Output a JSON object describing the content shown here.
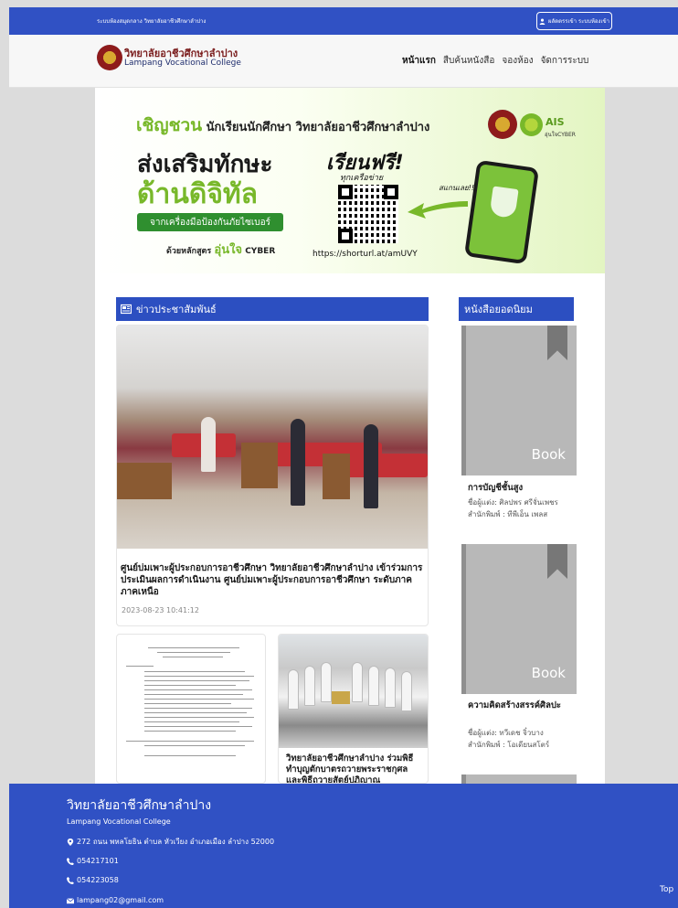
{
  "topbar": {
    "breadcrumb": "ระบบห้องสมุดกลาง วิทยาลัยอาชีวศึกษาลำปาง",
    "login_label": "ผลัดตรรเข้า ระบบห้องเข้า"
  },
  "brand": {
    "name_th": "วิทยาลัยอาชีวศึกษาลำปาง",
    "name_en": "Lampang Vocational College"
  },
  "menu": {
    "items": [
      "หน้าแรก",
      "สืบค้นหนังสือ",
      "จองห้อง",
      "จัดการระบบ"
    ]
  },
  "banner": {
    "invite_highlight": "เชิญชวน",
    "invite_rest": "นักเรียนนักศึกษา วิทยาลัยอาชีวศึกษาลำปาง",
    "ais_logo": "AIS",
    "ais_sub": "อุ่นใจCYBER",
    "headline1": "ส่งเสริมทักษะ",
    "headline2": "ด้านดิจิทัล",
    "pill": "จากเครื่องมือป้องกันภัยไซเบอร์",
    "course_prefix": "ด้วยหลักสูตร",
    "course_highlight": "อุ่นใจ",
    "course_suffix": "CYBER",
    "free": "เรียนฟรี!",
    "every_network": "ทุกเครือข่าย",
    "scan": "สแกนเลย!!",
    "url": "https://shorturl.at/amUVY"
  },
  "news": {
    "header": "ข่าวประชาสัมพันธ์",
    "featured_title": "ศูนย์บ่มเพาะผู้ประกอบการอาชีวศึกษา วิทยาลัยอาชีวศึกษาลำปาง เข้าร่วมการประเมินผลการดำเนินงาน ศูนย์บ่มเพาะผู้ประกอบการอาชีวศึกษา ระดับภาค ภาคเหนือ",
    "featured_date": "2023-08-23 10:41:12",
    "second_title": "วิทยาลัยอาชีวศึกษาลำปาง ร่วมพิธีทำบุญตักบาตรถวายพระราชกุศล และพิธีถวายสัตย์ปฏิญาณ"
  },
  "books": {
    "header": "หนังสือยอดนิยม",
    "cover_label": "Book",
    "items": [
      {
        "title": "การบัญชีชั้นสูง",
        "author": "ชื่อผู้แต่ง: ศิลปพร ศรีจั่นเพชร",
        "publisher": "สำนักพิมพ์ : ทีพีเอ็น เพลส"
      },
      {
        "title": "ความคิดสร้างสรรค์ศิลปะ",
        "author": "ชื่อผู้แต่ง: ทวีเดช จิ๋วบาง",
        "publisher": "สำนักพิมพ์ : โอเดียนสโตร์"
      }
    ]
  },
  "footer": {
    "title": "วิทยาลัยอาชีวศึกษาลำปาง",
    "subtitle": "Lampang Vocational College",
    "address": "272 ถนน พหลโยธิน ตำบล หัวเวียง อำเภอเมือง ลำปาง 52000",
    "phone1": "054217101",
    "phone2": "054223058",
    "email": "lampang02@gmail.com",
    "top_link": "Top"
  },
  "colors": {
    "primary": "#3051c4",
    "header_blue": "#2c4fc1",
    "accent_green": "#78b82a",
    "book_gray": "#b8b8b8"
  }
}
